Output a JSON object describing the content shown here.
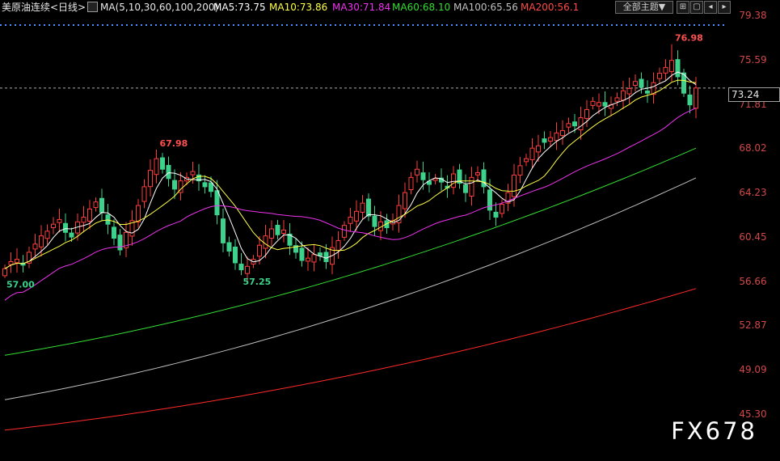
{
  "header": {
    "instrument": "美原油连续",
    "period": "<日线>",
    "ma_params": "MA(5,10,30,60,100,200)",
    "ma5": "MA5:73.75",
    "ma10": "MA10:73.86",
    "ma30": "MA30:71.84",
    "ma60": "MA60:68.10",
    "ma100": "MA100:65.56",
    "ma200": "MA200:56.1",
    "theme_button": "全部主题▼"
  },
  "colors": {
    "up": "#ff3c3c",
    "down": "#3cd28c",
    "ma5": "#ffffff",
    "ma10": "#ffff44",
    "ma30": "#ee33ee",
    "ma60": "#33dd33",
    "ma100": "#c0c0c0",
    "ma200": "#ff2a2a",
    "axis_text": "#d04848",
    "dotted": "#4a90ff"
  },
  "axis": {
    "ticks": [
      "79.38",
      "75.59",
      "71.81",
      "68.02",
      "64.23",
      "60.45",
      "56.66",
      "52.87",
      "49.09",
      "45.30"
    ],
    "current_price": "73.24"
  },
  "annotations": {
    "high1": "67.98",
    "low1": "57.00",
    "low2": "57.25",
    "high2": "76.98"
  },
  "watermark": "FX678",
  "chart_data": {
    "type": "candlestick",
    "ylim": [
      45.3,
      79.38
    ],
    "current_price": 73.24,
    "highs_lows": [
      {
        "label": "low",
        "value": 57.0
      },
      {
        "label": "high",
        "value": 67.98
      },
      {
        "label": "low",
        "value": 57.25
      },
      {
        "label": "high",
        "value": 76.98
      }
    ],
    "moving_averages_last": {
      "MA5": 73.75,
      "MA10": 73.86,
      "MA30": 71.84,
      "MA60": 68.1,
      "MA100": 65.56,
      "MA200": 56.1
    },
    "closes": [
      57.8,
      58.4,
      58.6,
      58.1,
      59.2,
      59.9,
      60.6,
      61.0,
      61.6,
      62.0,
      60.9,
      60.5,
      61.8,
      62.2,
      62.9,
      63.5,
      62.6,
      61.6,
      60.4,
      59.4,
      60.9,
      61.9,
      63.2,
      64.8,
      66.2,
      67.2,
      66.3,
      65.5,
      64.6,
      65.3,
      65.6,
      66.1,
      65.3,
      64.8,
      64.4,
      62.4,
      60.0,
      59.3,
      58.3,
      57.7,
      58.0,
      58.6,
      59.8,
      60.6,
      61.2,
      60.7,
      61.1,
      59.8,
      59.2,
      58.5,
      58.7,
      59.0,
      58.9,
      58.4,
      59.6,
      60.2,
      61.5,
      62.2,
      62.7,
      63.4,
      62.3,
      61.4,
      61.8,
      61.3,
      61.9,
      63.2,
      64.3,
      65.6,
      66.3,
      65.4,
      65.0,
      65.5,
      65.2,
      64.7,
      65.9,
      65.1,
      64.3,
      65.6,
      66.0,
      64.8,
      62.8,
      62.2,
      63.3,
      64.3,
      65.8,
      66.6,
      67.2,
      68.1,
      68.3,
      68.6,
      69.0,
      69.4,
      69.6,
      70.2,
      70.0,
      70.7,
      71.4,
      72.1,
      72.0,
      71.7,
      71.8,
      72.4,
      73.0,
      73.2,
      73.8,
      73.3,
      72.8,
      73.7,
      74.5,
      75.0,
      75.6,
      74.2,
      72.8,
      71.8,
      73.24
    ]
  }
}
